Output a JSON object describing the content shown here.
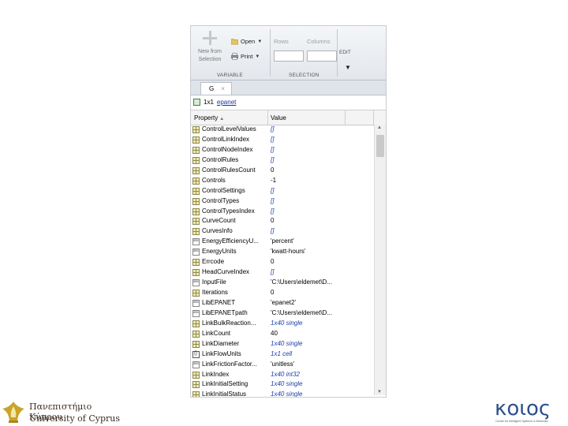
{
  "ribbon": {
    "new_from_selection": "New from\nSelection",
    "open": "Open",
    "print": "Print",
    "rows": "Rows",
    "columns": "Columns",
    "edit": "EDIT",
    "section_variable": "VARIABLE",
    "section_selection": "SELECTION"
  },
  "tab": {
    "label": "G",
    "close": "×"
  },
  "object": {
    "size": "1x1",
    "class_link": "epanet"
  },
  "table": {
    "col_property": "Property",
    "col_value": "Value",
    "rows": [
      {
        "name": "ControlLevelValues",
        "value": "[]",
        "icon": "grid",
        "italic": true
      },
      {
        "name": "ControlLinkIndex",
        "value": "[]",
        "icon": "grid",
        "italic": true
      },
      {
        "name": "ControlNodeIndex",
        "value": "[]",
        "icon": "grid",
        "italic": true
      },
      {
        "name": "ControlRules",
        "value": "[]",
        "icon": "grid",
        "italic": true
      },
      {
        "name": "ControlRulesCount",
        "value": "0",
        "icon": "grid",
        "italic": false
      },
      {
        "name": "Controls",
        "value": "-1",
        "icon": "grid",
        "italic": false
      },
      {
        "name": "ControlSettings",
        "value": "[]",
        "icon": "grid",
        "italic": true
      },
      {
        "name": "ControlTypes",
        "value": "[]",
        "icon": "grid",
        "italic": true
      },
      {
        "name": "ControlTypesIndex",
        "value": "[]",
        "icon": "grid",
        "italic": true
      },
      {
        "name": "CurveCount",
        "value": "0",
        "icon": "grid",
        "italic": false
      },
      {
        "name": "CurvesInfo",
        "value": "[]",
        "icon": "grid",
        "italic": true
      },
      {
        "name": "EnergyEfficiencyU...",
        "value": "'percent'",
        "icon": "abc",
        "italic": false
      },
      {
        "name": "EnergyUnits",
        "value": "'kwatt-hours'",
        "icon": "abc",
        "italic": false
      },
      {
        "name": "Errcode",
        "value": "0",
        "icon": "grid",
        "italic": false
      },
      {
        "name": "HeadCurveIndex",
        "value": "[]",
        "icon": "grid",
        "italic": true
      },
      {
        "name": "InputFile",
        "value": "'C:\\Users\\eldemet\\D...",
        "icon": "abc",
        "italic": false
      },
      {
        "name": "Iterations",
        "value": "0",
        "icon": "grid",
        "italic": false
      },
      {
        "name": "LibEPANET",
        "value": "'epanet2'",
        "icon": "abc",
        "italic": false
      },
      {
        "name": "LibEPANETpath",
        "value": "'C:\\Users\\eldemet\\D...",
        "icon": "abc",
        "italic": false
      },
      {
        "name": "LinkBulkReaction...",
        "value": "1x40 single",
        "icon": "grid",
        "italic": true
      },
      {
        "name": "LinkCount",
        "value": "40",
        "icon": "grid",
        "italic": false
      },
      {
        "name": "LinkDiameter",
        "value": "1x40 single",
        "icon": "grid",
        "italic": true
      },
      {
        "name": "LinkFlowUnits",
        "value": "1x1 cell",
        "icon": "cell",
        "italic": true
      },
      {
        "name": "LinkFrictionFactor...",
        "value": "'unitless'",
        "icon": "abc",
        "italic": false
      },
      {
        "name": "LinkIndex",
        "value": "1x40 int32",
        "icon": "grid",
        "italic": true
      },
      {
        "name": "LinkInitialSetting",
        "value": "1x40 single",
        "icon": "grid",
        "italic": true
      },
      {
        "name": "LinkInitialStatus",
        "value": "1x40 single",
        "icon": "grid",
        "italic": true
      }
    ]
  },
  "logos": {
    "ucy_greek": "Πανεπιστήμιο Κύπρου",
    "ucy_english": "University of Cyprus",
    "koios_word": "κοιος",
    "koios_sub": "Centre for Intelligent Systems & Networks"
  },
  "colors": {
    "link_blue": "#1a33a6",
    "value_italic_blue": "#1b3fa8",
    "koios_blue": "#2d4f8c",
    "ucy_gold": "#c9a32a"
  }
}
